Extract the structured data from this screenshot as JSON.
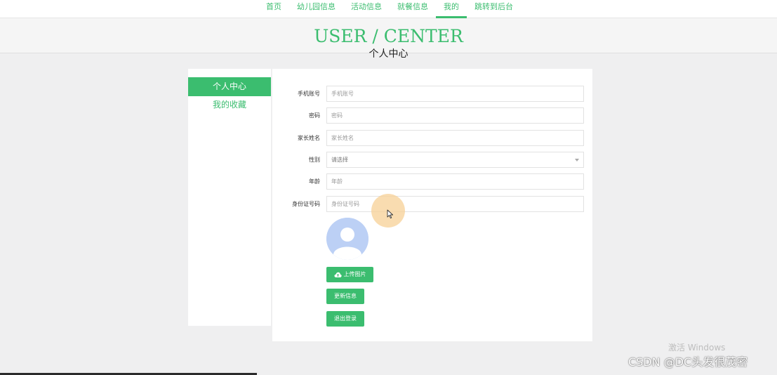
{
  "nav": {
    "items": [
      {
        "label": "首页",
        "active": false
      },
      {
        "label": "幼儿园信息",
        "active": false
      },
      {
        "label": "活动信息",
        "active": false
      },
      {
        "label": "就餐信息",
        "active": false
      },
      {
        "label": "我的",
        "active": true
      },
      {
        "label": "跳转到后台",
        "active": false
      }
    ]
  },
  "header": {
    "en_title": "USER / CENTER",
    "cn_title": "个人中心"
  },
  "sidebar": {
    "items": [
      {
        "label": "个人中心",
        "active": true
      },
      {
        "label": "我的收藏",
        "active": false
      }
    ]
  },
  "form": {
    "phone": {
      "label": "手机账号",
      "placeholder": "手机账号",
      "value": ""
    },
    "password": {
      "label": "密码",
      "placeholder": "密码",
      "value": ""
    },
    "parent_name": {
      "label": "家长姓名",
      "placeholder": "家长姓名",
      "value": ""
    },
    "gender": {
      "label": "性别",
      "selected": "请选择"
    },
    "age": {
      "label": "年龄",
      "placeholder": "年龄",
      "value": ""
    },
    "id_number": {
      "label": "身份证号码",
      "placeholder": "身份证号码",
      "value": ""
    }
  },
  "buttons": {
    "upload": "上传图片",
    "update": "更新信息",
    "logout": "退出登录"
  },
  "watermarks": {
    "windows": "激活 Windows",
    "csdn": "CSDN @DC头发很茂密"
  },
  "colors": {
    "accent": "#3bbd6f",
    "avatar_bg": "#bcd0f5"
  },
  "icons": {
    "upload": "cloud-upload-icon",
    "avatar": "user-avatar-icon",
    "cursor": "mouse-pointer-icon"
  }
}
